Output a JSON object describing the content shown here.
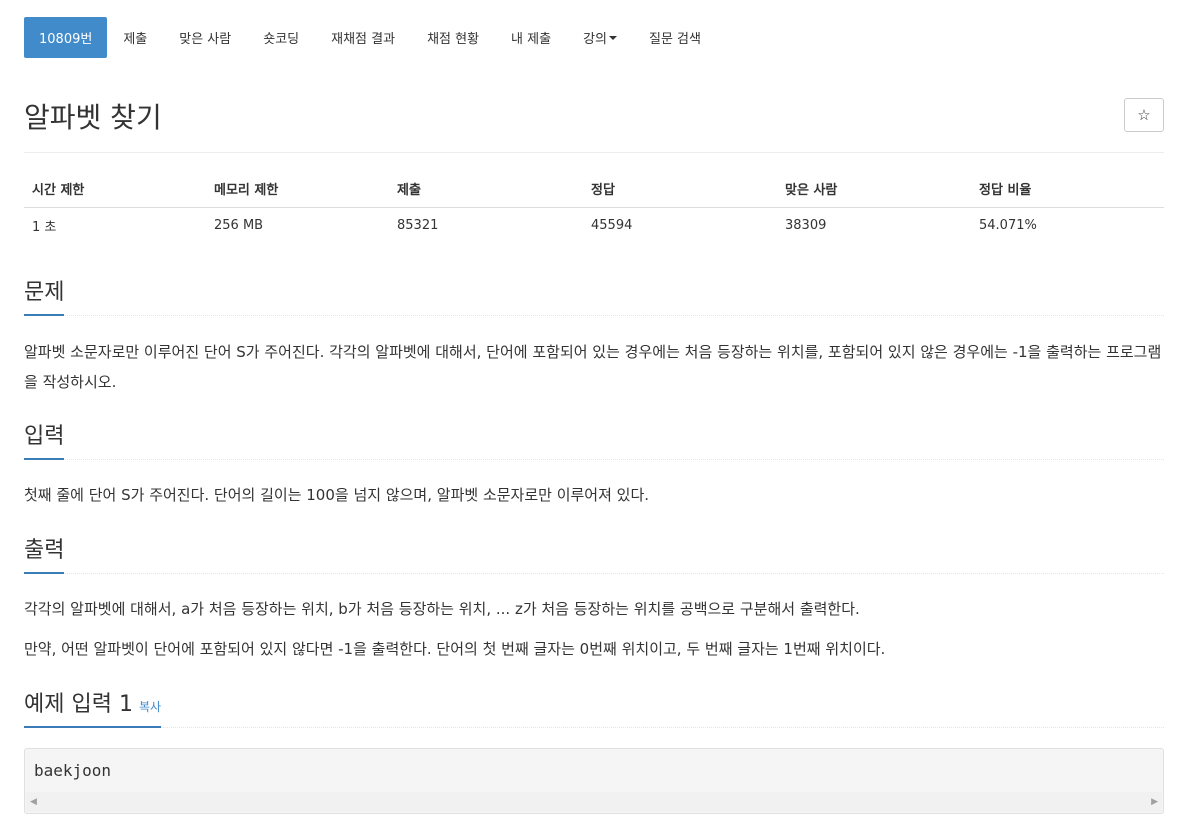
{
  "nav": {
    "items": [
      "10809번",
      "제출",
      "맞은 사람",
      "숏코딩",
      "재채점 결과",
      "채점 현황",
      "내 제출",
      "강의",
      "질문 검색"
    ]
  },
  "problem": {
    "title": "알파벳 찾기",
    "star_icon": "☆"
  },
  "stats": {
    "headers": [
      "시간 제한",
      "메모리 제한",
      "제출",
      "정답",
      "맞은 사람",
      "정답 비율"
    ],
    "values": [
      "1 초",
      "256 MB",
      "85321",
      "45594",
      "38309",
      "54.071%"
    ]
  },
  "sections": {
    "problem_heading": "문제",
    "problem_text": "알파벳 소문자로만 이루어진 단어 S가 주어진다. 각각의 알파벳에 대해서, 단어에 포함되어 있는 경우에는 처음 등장하는 위치를, 포함되어 있지 않은 경우에는 -1을 출력하는 프로그램을 작성하시오.",
    "input_heading": "입력",
    "input_text": "첫째 줄에 단어 S가 주어진다. 단어의 길이는 100을 넘지 않으며, 알파벳 소문자로만 이루어져 있다.",
    "output_heading": "출력",
    "output_text_1": "각각의 알파벳에 대해서, a가 처음 등장하는 위치, b가 처음 등장하는 위치, ... z가 처음 등장하는 위치를 공백으로 구분해서 출력한다.",
    "output_text_2": "만약, 어떤 알파벳이 단어에 포함되어 있지 않다면 -1을 출력한다. 단어의 첫 번째 글자는 0번째 위치이고, 두 번째 글자는 1번째 위치이다.",
    "sample_heading": "예제 입력 1",
    "copy_label": "복사",
    "sample_input": "baekjoon"
  },
  "colors": {
    "accent": "#428bca",
    "underline": "#3a7cb8"
  }
}
